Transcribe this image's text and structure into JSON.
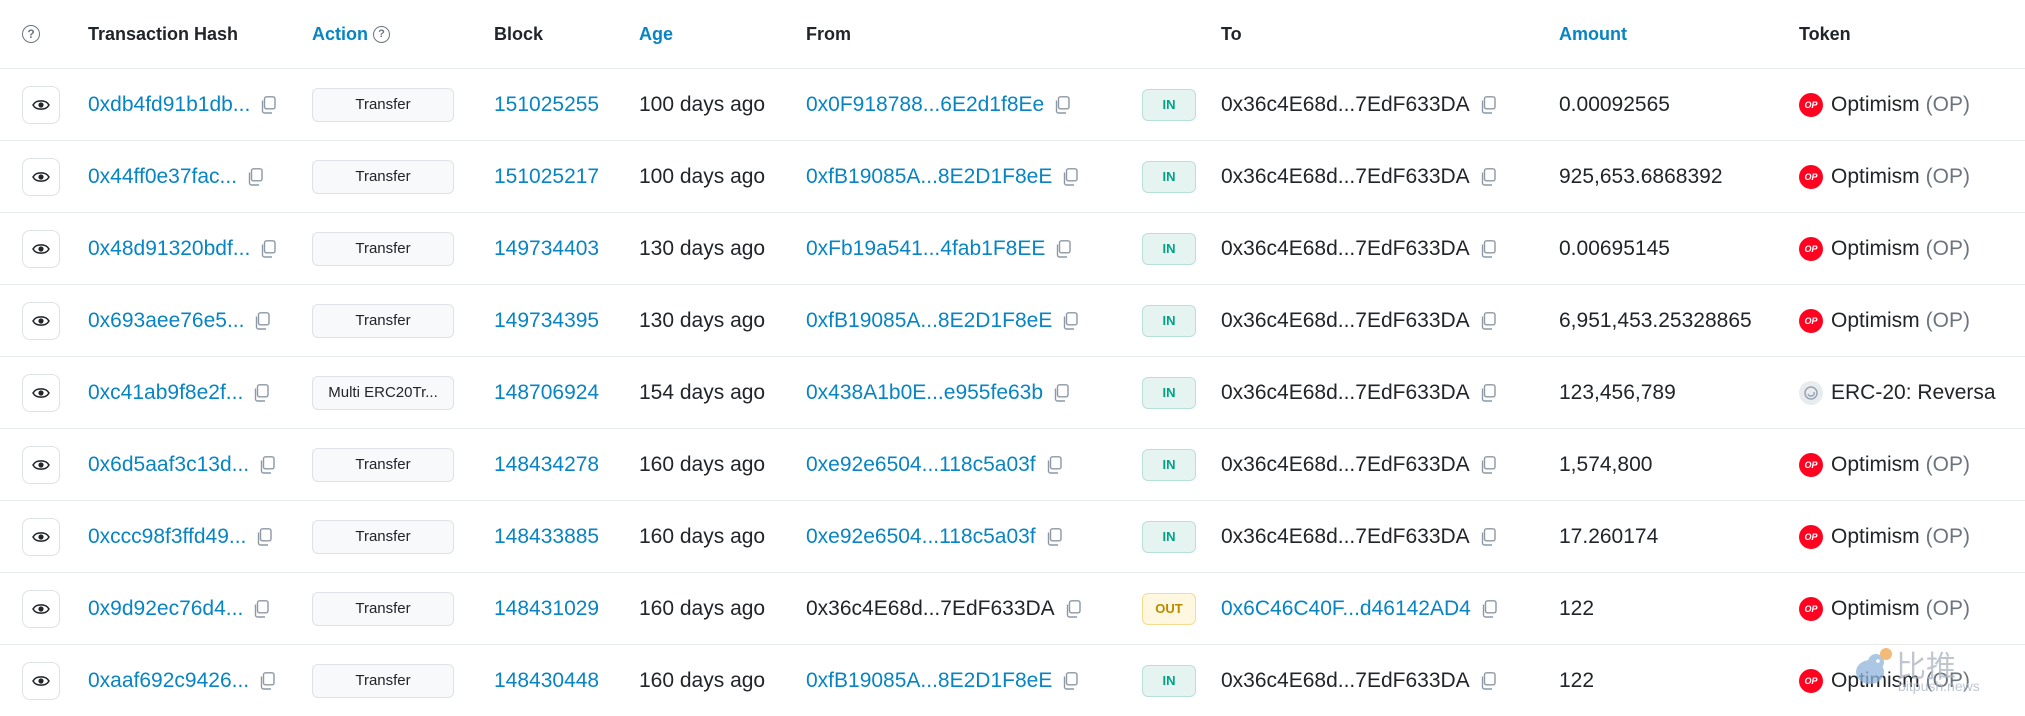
{
  "headers": {
    "transaction_hash": "Transaction Hash",
    "action": "Action",
    "block": "Block",
    "age": "Age",
    "from": "From",
    "to": "To",
    "amount": "Amount",
    "token": "Token"
  },
  "colors": {
    "link": "#0784c3",
    "in_badge": "#00a186",
    "out_badge": "#b88a00",
    "optimism": "#ff0420"
  },
  "rows": [
    {
      "hash": "0xdb4fd91b1db...",
      "action": "Transfer",
      "block": "151025255",
      "age": "100 days ago",
      "from": "0x0F918788...6E2d1f8Ee",
      "direction": "IN",
      "to": "0x36c4E68d...7EdF633DA",
      "amount": "0.00092565",
      "token": "Optimism",
      "symbol": "(OP)"
    },
    {
      "hash": "0x44ff0e37fac...",
      "action": "Transfer",
      "block": "151025217",
      "age": "100 days ago",
      "from": "0xfB19085A...8E2D1F8eE",
      "direction": "IN",
      "to": "0x36c4E68d...7EdF633DA",
      "amount": "925,653.6868392",
      "token": "Optimism",
      "symbol": "(OP)"
    },
    {
      "hash": "0x48d91320bdf...",
      "action": "Transfer",
      "block": "149734403",
      "age": "130 days ago",
      "from": "0xFb19a541...4fab1F8EE",
      "direction": "IN",
      "to": "0x36c4E68d...7EdF633DA",
      "amount": "0.00695145",
      "token": "Optimism",
      "symbol": "(OP)"
    },
    {
      "hash": "0x693aee76e5...",
      "action": "Transfer",
      "block": "149734395",
      "age": "130 days ago",
      "from": "0xfB19085A...8E2D1F8eE",
      "direction": "IN",
      "to": "0x36c4E68d...7EdF633DA",
      "amount": "6,951,453.25328865",
      "token": "Optimism",
      "symbol": "(OP)"
    },
    {
      "hash": "0xc41ab9f8e2f...",
      "action": "Multi ERC20Tr...",
      "block": "148706924",
      "age": "154 days ago",
      "from": "0x438A1b0E...e955fe63b",
      "direction": "IN",
      "to": "0x36c4E68d...7EdF633DA",
      "amount": "123,456,789",
      "token": "ERC-20: Reversa",
      "symbol": ""
    },
    {
      "hash": "0x6d5aaf3c13d...",
      "action": "Transfer",
      "block": "148434278",
      "age": "160 days ago",
      "from": "0xe92e6504...118c5a03f",
      "direction": "IN",
      "to": "0x36c4E68d...7EdF633DA",
      "amount": "1,574,800",
      "token": "Optimism",
      "symbol": "(OP)"
    },
    {
      "hash": "0xccc98f3ffd49...",
      "action": "Transfer",
      "block": "148433885",
      "age": "160 days ago",
      "from": "0xe92e6504...118c5a03f",
      "direction": "IN",
      "to": "0x36c4E68d...7EdF633DA",
      "amount": "17.260174",
      "token": "Optimism",
      "symbol": "(OP)"
    },
    {
      "hash": "0x9d92ec76d4...",
      "action": "Transfer",
      "block": "148431029",
      "age": "160 days ago",
      "from": "0x36c4E68d...7EdF633DA",
      "direction": "OUT",
      "to": "0x6C46C40F...d46142AD4",
      "amount": "122",
      "token": "Optimism",
      "symbol": "(OP)"
    },
    {
      "hash": "0xaaf692c9426...",
      "action": "Transfer",
      "block": "148430448",
      "age": "160 days ago",
      "from": "0xfB19085A...8E2D1F8eE",
      "direction": "IN",
      "to": "0x36c4E68d...7EdF633DA",
      "amount": "122",
      "token": "Optimism",
      "symbol": "(OP)"
    }
  ],
  "watermark": {
    "text": "比推",
    "sub": "bitpush.news"
  }
}
